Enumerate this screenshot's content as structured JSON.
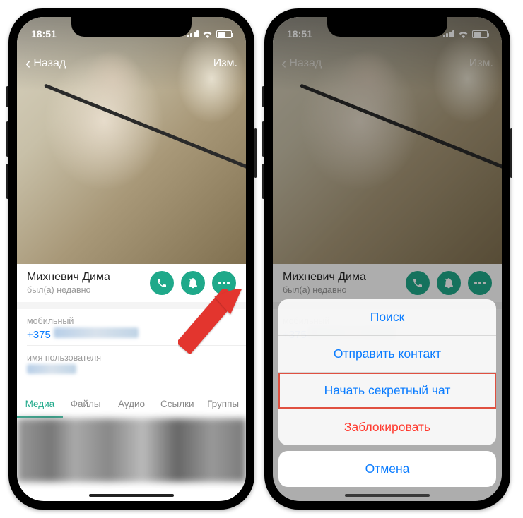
{
  "statusbar": {
    "time": "18:51"
  },
  "nav": {
    "back": "Назад",
    "edit": "Изм."
  },
  "contact": {
    "name": "Михневич Дима",
    "status": "был(а) недавно",
    "phone_label": "мобильный",
    "phone_value": "+375",
    "username_label": "имя пользователя"
  },
  "tabs": {
    "media": "Медиа",
    "files": "Файлы",
    "audio": "Аудио",
    "links": "Ссылки",
    "groups": "Группы"
  },
  "sheet": {
    "search": "Поиск",
    "share": "Отправить контакт",
    "secret": "Начать секретный чат",
    "block": "Заблокировать",
    "cancel": "Отмена"
  },
  "icons": {
    "call": "call-icon",
    "mute": "mute-bell-icon",
    "more": "more-icon"
  }
}
